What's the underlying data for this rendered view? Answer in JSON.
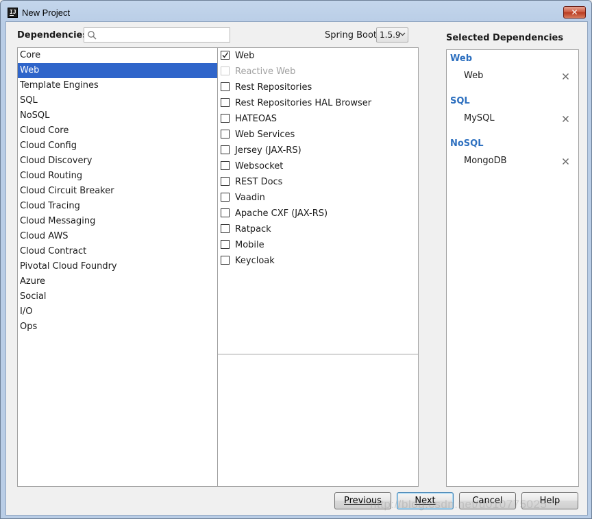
{
  "window": {
    "title": "New Project",
    "close_glyph": "✕"
  },
  "header": {
    "dependencies_label": "Dependencies",
    "search_placeholder": "",
    "search_value": "",
    "spring_boot_label": "Spring Boot",
    "spring_boot_version": "1.5.9",
    "selected_title": "Selected Dependencies"
  },
  "categories": [
    {
      "label": "Core",
      "selected": false
    },
    {
      "label": "Web",
      "selected": true
    },
    {
      "label": "Template Engines",
      "selected": false
    },
    {
      "label": "SQL",
      "selected": false
    },
    {
      "label": "NoSQL",
      "selected": false
    },
    {
      "label": "Cloud Core",
      "selected": false
    },
    {
      "label": "Cloud Config",
      "selected": false
    },
    {
      "label": "Cloud Discovery",
      "selected": false
    },
    {
      "label": "Cloud Routing",
      "selected": false
    },
    {
      "label": "Cloud Circuit Breaker",
      "selected": false
    },
    {
      "label": "Cloud Tracing",
      "selected": false
    },
    {
      "label": "Cloud Messaging",
      "selected": false
    },
    {
      "label": "Cloud AWS",
      "selected": false
    },
    {
      "label": "Cloud Contract",
      "selected": false
    },
    {
      "label": "Pivotal Cloud Foundry",
      "selected": false
    },
    {
      "label": "Azure",
      "selected": false
    },
    {
      "label": "Social",
      "selected": false
    },
    {
      "label": "I/O",
      "selected": false
    },
    {
      "label": "Ops",
      "selected": false
    }
  ],
  "dependencies": [
    {
      "label": "Web",
      "checked": true,
      "disabled": false
    },
    {
      "label": "Reactive Web",
      "checked": false,
      "disabled": true
    },
    {
      "label": "Rest Repositories",
      "checked": false,
      "disabled": false
    },
    {
      "label": "Rest Repositories HAL Browser",
      "checked": false,
      "disabled": false
    },
    {
      "label": "HATEOAS",
      "checked": false,
      "disabled": false
    },
    {
      "label": "Web Services",
      "checked": false,
      "disabled": false
    },
    {
      "label": "Jersey (JAX-RS)",
      "checked": false,
      "disabled": false
    },
    {
      "label": "Websocket",
      "checked": false,
      "disabled": false
    },
    {
      "label": "REST Docs",
      "checked": false,
      "disabled": false
    },
    {
      "label": "Vaadin",
      "checked": false,
      "disabled": false
    },
    {
      "label": "Apache CXF (JAX-RS)",
      "checked": false,
      "disabled": false
    },
    {
      "label": "Ratpack",
      "checked": false,
      "disabled": false
    },
    {
      "label": "Mobile",
      "checked": false,
      "disabled": false
    },
    {
      "label": "Keycloak",
      "checked": false,
      "disabled": false
    }
  ],
  "selected_groups": [
    {
      "title": "Web",
      "items": [
        "Web"
      ]
    },
    {
      "title": "SQL",
      "items": [
        "MySQL"
      ]
    },
    {
      "title": "NoSQL",
      "items": [
        "MongoDB"
      ]
    }
  ],
  "buttons": {
    "previous": "Previous",
    "next": "Next",
    "cancel": "Cancel",
    "help": "Help"
  },
  "watermark": "http://blog.csdn.net/u010775025",
  "colors": {
    "selection_blue": "#2f65ca",
    "group_title_blue": "#2c6fbf"
  }
}
